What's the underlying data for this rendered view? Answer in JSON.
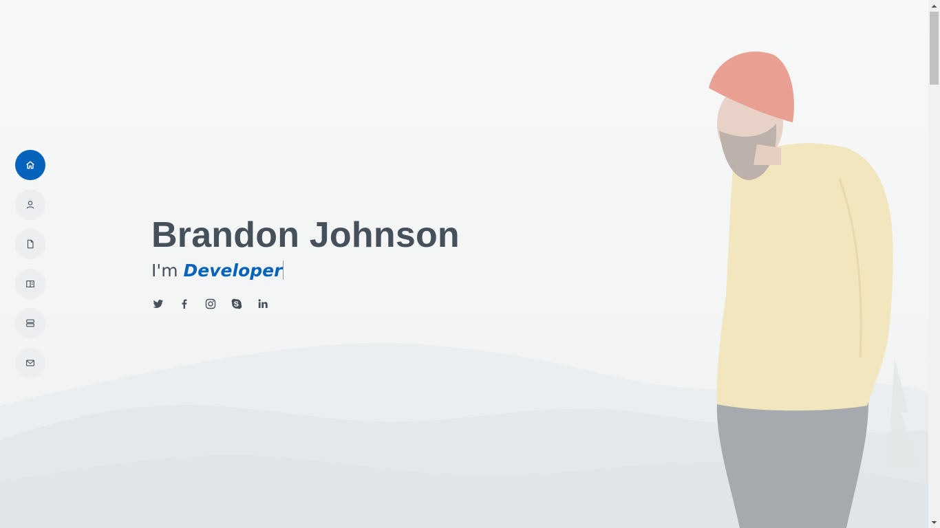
{
  "hero": {
    "name": "Brandon Johnson",
    "tagline_prefix": "I'm ",
    "tagline_role": "Developer"
  },
  "nav": {
    "items": [
      {
        "icon": "home-icon",
        "active": true
      },
      {
        "icon": "person-icon",
        "active": false
      },
      {
        "icon": "file-icon",
        "active": false
      },
      {
        "icon": "book-icon",
        "active": false
      },
      {
        "icon": "server-icon",
        "active": false
      },
      {
        "icon": "envelope-icon",
        "active": false
      }
    ]
  },
  "social": {
    "links": [
      {
        "icon": "twitter-icon"
      },
      {
        "icon": "facebook-icon"
      },
      {
        "icon": "instagram-icon"
      },
      {
        "icon": "skype-icon"
      },
      {
        "icon": "linkedin-icon"
      }
    ]
  },
  "colors": {
    "accent": "#0563bb",
    "heading": "#45505b",
    "nav_bg": "#eceeef"
  }
}
